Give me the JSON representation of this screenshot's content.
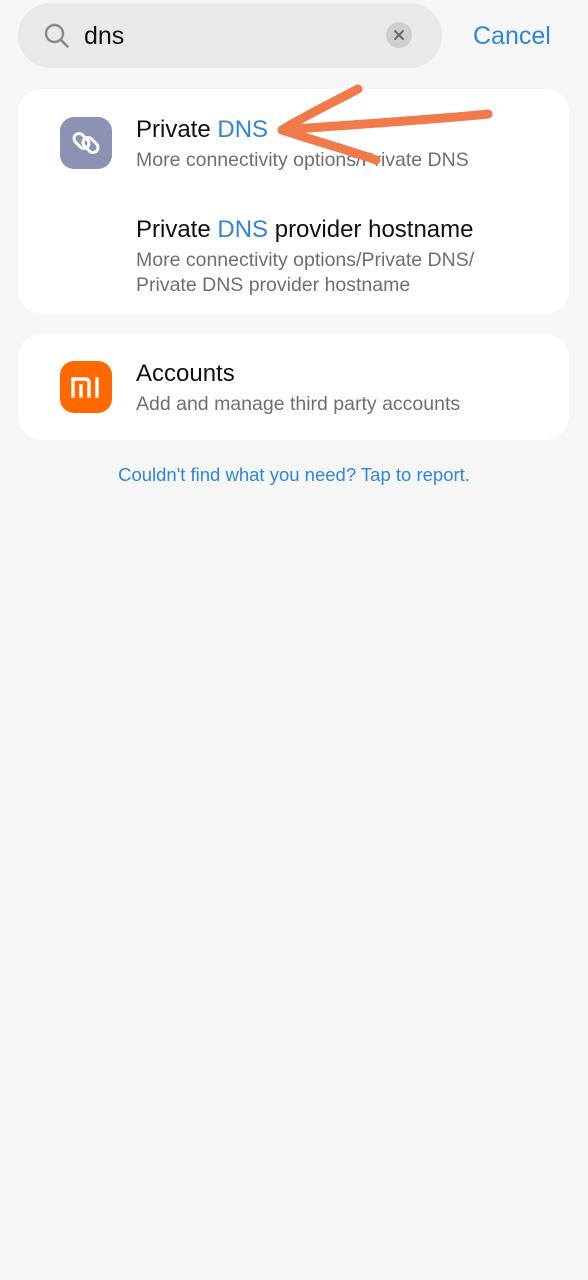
{
  "search": {
    "query": "dns",
    "cancel_label": "Cancel"
  },
  "results": [
    {
      "title_prefix": "Private ",
      "title_highlight": "DNS",
      "title_suffix": "",
      "subtitle": "More connectivity options/Private DNS",
      "icon": "link-icon"
    },
    {
      "title_prefix": "Private ",
      "title_highlight": "DNS",
      "title_suffix": " provider hostname",
      "subtitle": "More connectivity options/Private DNS/ Private DNS provider hostname",
      "icon": ""
    },
    {
      "title_prefix": "Accounts",
      "title_highlight": "",
      "title_suffix": "",
      "subtitle": "Add and manage third party accounts",
      "icon": "mi-logo-icon"
    }
  ],
  "footer": {
    "report_text": "Couldn't find what you need? Tap to report."
  },
  "colors": {
    "accent": "#2f86d8",
    "annotation": "#f07a4a",
    "mi_orange": "#ff6900",
    "link_icon_bg": "#8b92b3"
  }
}
